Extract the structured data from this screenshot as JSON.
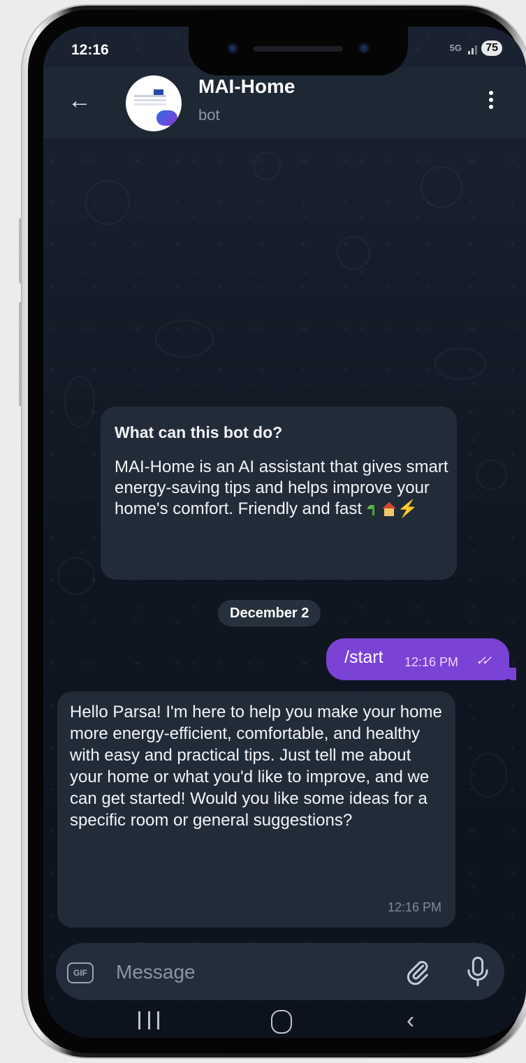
{
  "status_bar": {
    "time": "12:16",
    "network": "5G",
    "battery": "75"
  },
  "header": {
    "back_icon": "arrow-left-icon",
    "title": "MAI-Home",
    "subtitle": "bot",
    "menu_icon": "more-vertical-icon"
  },
  "bot_info": {
    "question": "What can this bot do?",
    "description": "MAI-Home is an AI assistant that gives smart energy-saving tips and helps improve your home's comfort. Friendly and fast",
    "emojis": [
      "seedling-icon",
      "house-icon",
      "lightning-icon"
    ]
  },
  "date_separator": "December 2",
  "messages": [
    {
      "from": "me",
      "text": "/start",
      "time": "12:16 PM",
      "status": "✓✓"
    },
    {
      "from": "bot",
      "text": "Hello Parsa! I'm here to help you make your home more energy-efficient, comfortable, and healthy with easy and practical tips. Just tell me about your home or what you'd like to improve, and we can get started! Would you like some ideas for a specific room or general suggestions?",
      "time": "12:16 PM"
    }
  ],
  "input": {
    "gif_label": "GIF",
    "placeholder": "Message",
    "attach_icon": "paperclip-icon",
    "mic_icon": "microphone-icon"
  },
  "nav_bar": {
    "recent_icon": "recent-apps-icon",
    "home_icon": "home-icon",
    "back_icon": "back-chevron-icon"
  },
  "colors": {
    "header_bg": "#1e2835",
    "bubble_bot": "#222c39",
    "bubble_me": "#7b42d6",
    "screen_bg": "#141b27"
  }
}
